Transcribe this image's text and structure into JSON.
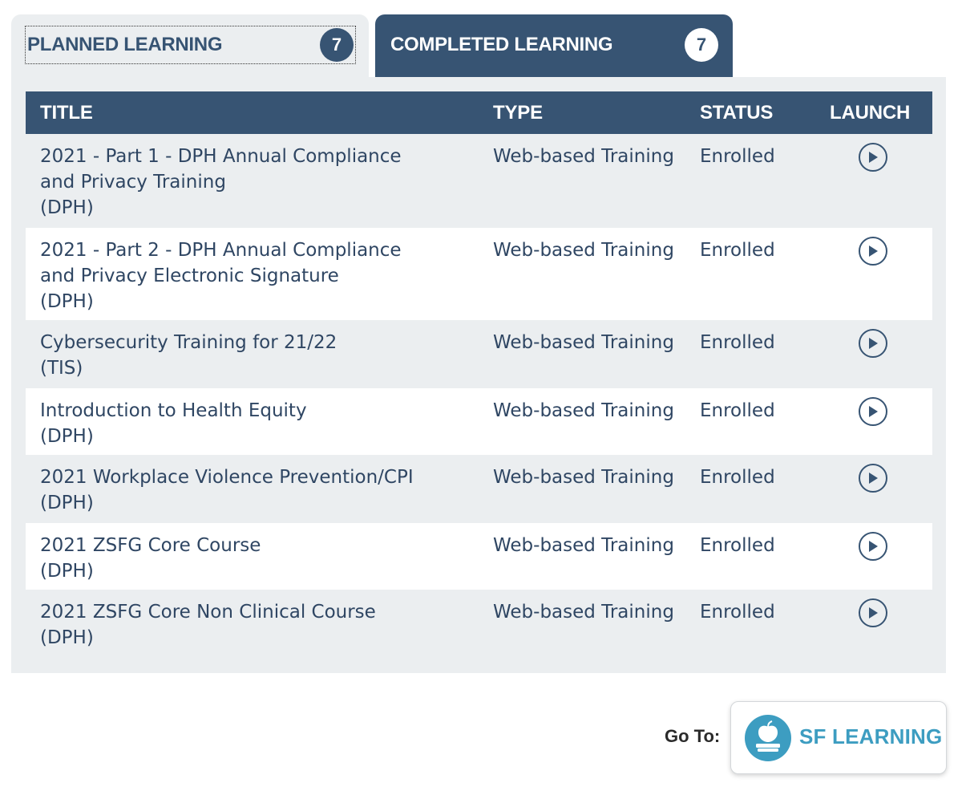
{
  "tabs": [
    {
      "label": "PLANNED LEARNING",
      "count": "7"
    },
    {
      "label": "COMPLETED LEARNING",
      "count": "7"
    }
  ],
  "table": {
    "headers": {
      "title": "TITLE",
      "type": "TYPE",
      "status": "STATUS",
      "launch": "LAUNCH"
    },
    "rows": [
      {
        "title": "2021 - Part 1 - DPH Annual Compliance and Privacy Training",
        "org": "(DPH)",
        "type": "Web-based Training",
        "status": "Enrolled"
      },
      {
        "title": "2021 - Part 2 - DPH Annual Compliance and Privacy Electronic Signature",
        "org": "(DPH)",
        "type": "Web-based Training",
        "status": "Enrolled"
      },
      {
        "title": "Cybersecurity Training for 21/22",
        "org": "(TIS)",
        "type": "Web-based Training",
        "status": "Enrolled"
      },
      {
        "title": "Introduction to Health Equity",
        "org": "(DPH)",
        "type": "Web-based Training",
        "status": "Enrolled"
      },
      {
        "title": "2021 Workplace Violence Prevention/CPI",
        "org": "(DPH)",
        "type": "Web-based Training",
        "status": "Enrolled"
      },
      {
        "title": "2021 ZSFG Core Course",
        "org": "(DPH)",
        "type": "Web-based Training",
        "status": "Enrolled"
      },
      {
        "title": "2021 ZSFG Core Non Clinical Course",
        "org": "(DPH)",
        "type": "Web-based Training",
        "status": "Enrolled"
      }
    ]
  },
  "footer": {
    "goto_label": "Go To:",
    "sf_learning_label": "SF LEARNING"
  },
  "colors": {
    "primary": "#375473",
    "panel": "#ebeef0",
    "sf_teal": "#3d9dc1"
  },
  "icons": {
    "launch": "play-circle-icon",
    "sf_logo": "apple-book-icon"
  }
}
